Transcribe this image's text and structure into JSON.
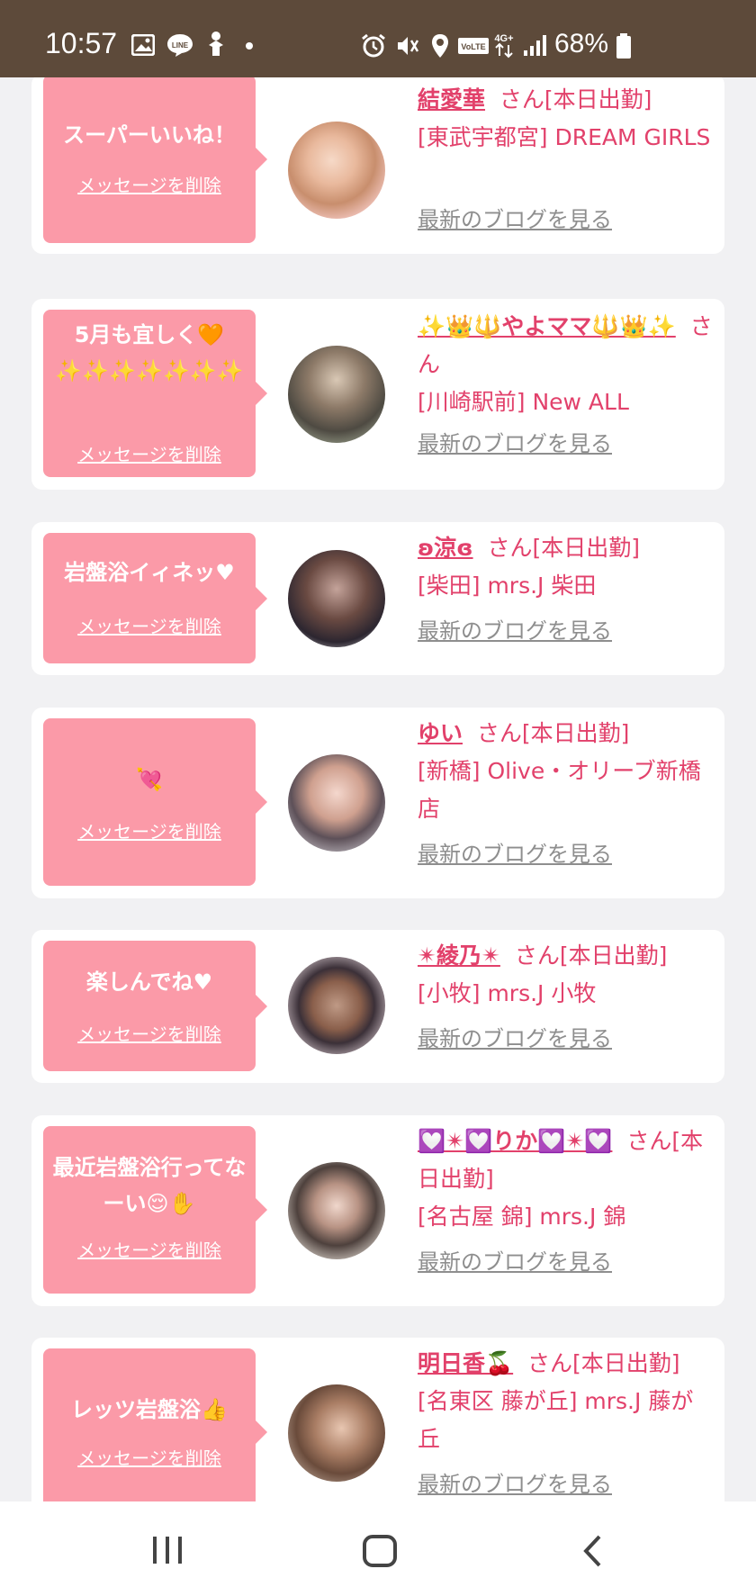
{
  "status_bar": {
    "time": "10:57",
    "battery": "68%",
    "network": "4G+",
    "volte": "VoLTE",
    "line_label": "LINE",
    "bg_color": "#5d4a3a"
  },
  "delete_label": "メッセージを削除",
  "blog_label": "最新のブログを見る",
  "colors": {
    "bubble": "#fb9aa8",
    "name": "#e2416b",
    "blog": "#8e8e8e"
  },
  "cards": [
    {
      "message": "スーパーいいね！",
      "name": "結愛華",
      "suffix": "さん[本日出勤]",
      "shop": "[東武宇都宮] DREAM GIRLS"
    },
    {
      "message": "5月も宜しく🧡✨✨✨✨✨✨✨",
      "name": "✨👑🔱やよママ🔱👑✨",
      "suffix": "さん",
      "shop": "[川崎駅前] New ALL"
    },
    {
      "message": "岩盤浴イィネッ♥",
      "name": "ʚ涼ɞ",
      "suffix": "さん[本日出勤]",
      "shop": "[柴田] mrs.J 柴田"
    },
    {
      "message": "💘",
      "name": "ゆい",
      "suffix": "さん[本日出勤]",
      "shop": "[新橋] Olive・オリーブ新橋店"
    },
    {
      "message": "楽しんでね♥",
      "name": "✴綾乃✴",
      "suffix": "さん[本日出勤]",
      "shop": "[小牧] mrs.J 小牧"
    },
    {
      "message": "最近岩盤浴行ってなーい😌✋",
      "name": "💟✴💟りか💟✴💟",
      "suffix": "さん[本日出勤]",
      "shop": "[名古屋 錦] mrs.J 錦"
    },
    {
      "message": "レッツ岩盤浴👍",
      "name": "明日香🍒",
      "suffix": "さん[本日出勤]",
      "shop": "[名東区 藤が丘] mrs.J 藤が丘"
    }
  ]
}
